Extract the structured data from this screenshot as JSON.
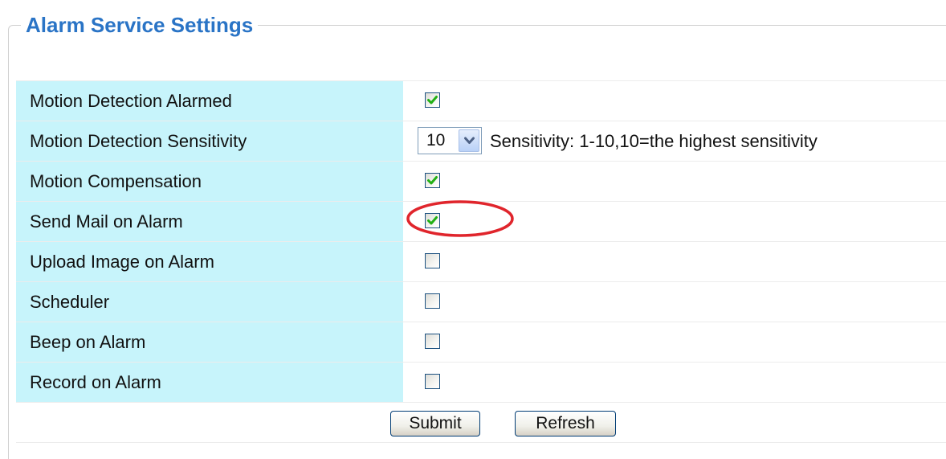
{
  "section": {
    "title": "Alarm Service Settings"
  },
  "rows": [
    {
      "label": "Motion Detection Alarmed",
      "type": "checkbox",
      "checked": true
    },
    {
      "label": "Motion Detection Sensitivity",
      "type": "select",
      "value": "10",
      "hint": "Sensitivity: 1-10,10=the highest sensitivity"
    },
    {
      "label": "Motion Compensation",
      "type": "checkbox",
      "checked": true
    },
    {
      "label": "Send Mail on Alarm",
      "type": "checkbox",
      "checked": true,
      "highlighted": true
    },
    {
      "label": "Upload Image on Alarm",
      "type": "checkbox",
      "checked": false
    },
    {
      "label": "Scheduler",
      "type": "checkbox",
      "checked": false
    },
    {
      "label": "Beep on Alarm",
      "type": "checkbox",
      "checked": false
    },
    {
      "label": "Record on Alarm",
      "type": "checkbox",
      "checked": false
    }
  ],
  "buttons": {
    "submit_label": "Submit",
    "refresh_label": "Refresh"
  },
  "colors": {
    "title": "#2a74c6",
    "label_cell_bg": "#c7f4fb",
    "checkmark": "#22b014",
    "highlight": "#e0252c"
  }
}
